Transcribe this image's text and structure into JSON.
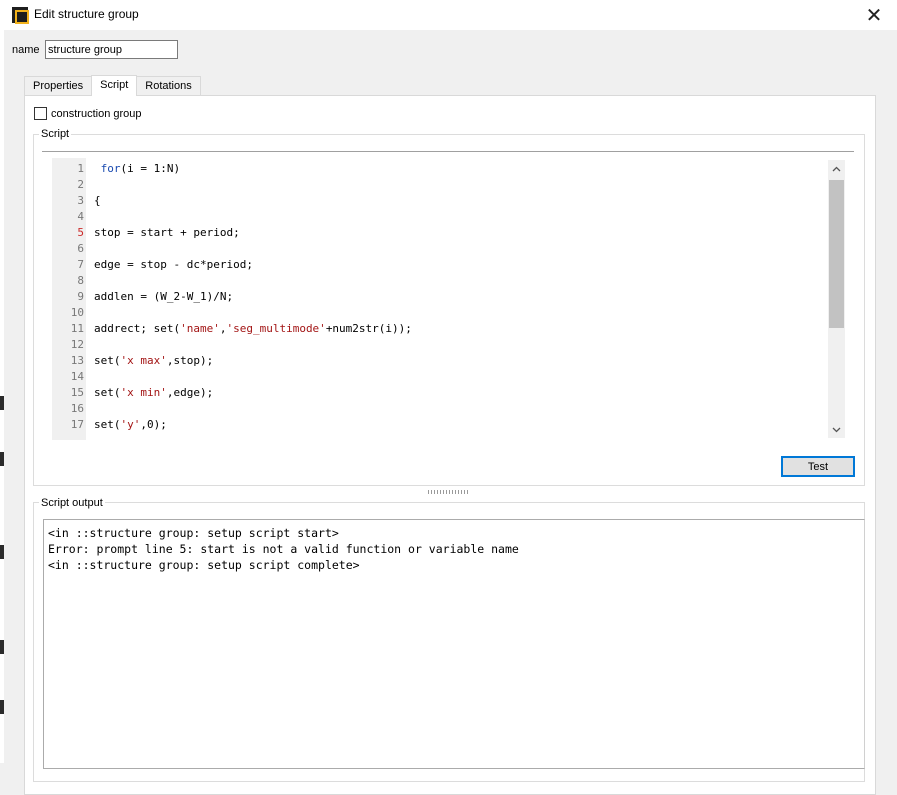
{
  "window": {
    "title": "Edit structure group",
    "close_glyph": "✕"
  },
  "name_field": {
    "label": "name",
    "value": "structure group"
  },
  "tabs": [
    {
      "label": "Properties",
      "active": false
    },
    {
      "label": "Script",
      "active": true
    },
    {
      "label": "Rotations",
      "active": false
    }
  ],
  "construction_group": {
    "label": "construction group",
    "checked": false
  },
  "script_group": {
    "title": "Script"
  },
  "script_lines": [
    {
      "n": "1",
      "tokens": [
        [
          "plain",
          " "
        ],
        [
          "kw",
          "for"
        ],
        [
          "plain",
          "(i = 1:N)"
        ]
      ]
    },
    {
      "n": "2",
      "tokens": []
    },
    {
      "n": "3",
      "tokens": [
        [
          "plain",
          "{"
        ]
      ]
    },
    {
      "n": "4",
      "tokens": []
    },
    {
      "n": "5",
      "error": true,
      "tokens": [
        [
          "plain",
          "stop = start + period;"
        ]
      ]
    },
    {
      "n": "6",
      "tokens": []
    },
    {
      "n": "7",
      "tokens": [
        [
          "plain",
          "edge = stop - dc*period;"
        ]
      ]
    },
    {
      "n": "8",
      "tokens": []
    },
    {
      "n": "9",
      "tokens": [
        [
          "plain",
          "addlen = (W_2-W_1)/N;"
        ]
      ]
    },
    {
      "n": "10",
      "tokens": []
    },
    {
      "n": "11",
      "tokens": [
        [
          "plain",
          "addrect; set("
        ],
        [
          "str",
          "'name'"
        ],
        [
          "plain",
          ","
        ],
        [
          "str",
          "'seg_multimode'"
        ],
        [
          "plain",
          "+num2str(i));"
        ]
      ]
    },
    {
      "n": "12",
      "tokens": []
    },
    {
      "n": "13",
      "tokens": [
        [
          "plain",
          "set("
        ],
        [
          "str",
          "'x max'"
        ],
        [
          "plain",
          ",stop);"
        ]
      ]
    },
    {
      "n": "14",
      "tokens": []
    },
    {
      "n": "15",
      "tokens": [
        [
          "plain",
          "set("
        ],
        [
          "str",
          "'x min'"
        ],
        [
          "plain",
          ",edge);"
        ]
      ]
    },
    {
      "n": "16",
      "tokens": []
    },
    {
      "n": "17",
      "tokens": [
        [
          "plain",
          "set("
        ],
        [
          "str",
          "'y'"
        ],
        [
          "plain",
          ",0);"
        ]
      ]
    }
  ],
  "scrollbar": {
    "up_glyph": "⌃",
    "down_glyph": "⌄",
    "up_icon": "chevron-up-icon",
    "down_icon": "chevron-down-icon"
  },
  "test_button": {
    "label": "Test"
  },
  "output_group": {
    "title": "Script output"
  },
  "output_lines": [
    "<in ::structure group: setup script start>",
    "Error: prompt line 5: start is not a valid function or variable name",
    "<in ::structure group: setup script complete>"
  ],
  "colors": {
    "keyword": "#1a4ab0",
    "string": "#a31515",
    "error_line_number": "#cc2a2a",
    "focus_border": "#0078d7"
  }
}
